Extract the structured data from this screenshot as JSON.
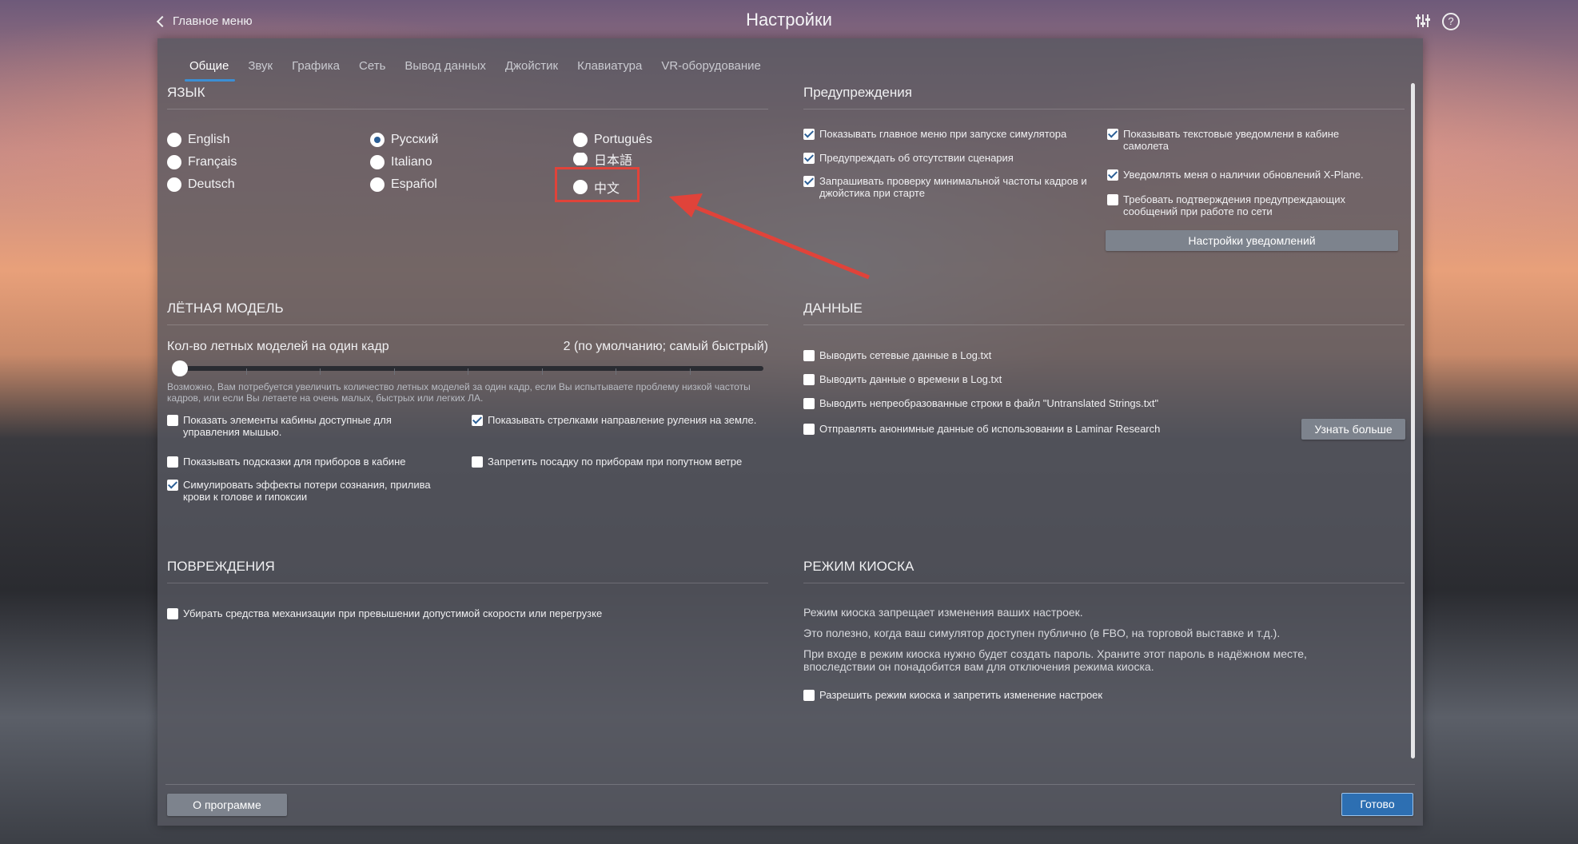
{
  "header": {
    "back_label": "Главное меню",
    "title": "Настройки",
    "settings_icon": "sliders-icon",
    "help_icon": "help-icon",
    "help_glyph": "?"
  },
  "tabs": [
    "Общие",
    "Звук",
    "Графика",
    "Сеть",
    "Вывод данных",
    "Джойстик",
    "Клавиатура",
    "VR-оборудование"
  ],
  "language": {
    "heading": "ЯЗЫК",
    "options": [
      "English",
      "Русский",
      "Português",
      "Français",
      "Italiano",
      "日本語",
      "Deutsch",
      "Español",
      "中文"
    ],
    "selected": "Русский"
  },
  "warnings": {
    "heading": "Предупреждения",
    "items": [
      {
        "label": "Показывать главное меню при запуске симулятора",
        "checked": true
      },
      {
        "label": "Предупреждать об отсутствии сценария",
        "checked": true
      },
      {
        "label": "Запрашивать проверку минимальной частоты кадров и джойстика при старте",
        "checked": true
      },
      {
        "label": "Показывать текстовые уведомлени в кабине самолета",
        "checked": true
      },
      {
        "label": "Уведомлять меня о наличии обновлений X-Plane.",
        "checked": true
      },
      {
        "label": "Требовать подтверждения предупреждающих сообщений при работе по сети",
        "checked": false
      }
    ],
    "button": "Настройки уведомлений"
  },
  "flight_model": {
    "heading": "ЛЁТНАЯ МОДЕЛЬ",
    "slider_label": "Кол-во летных моделей на один кадр",
    "slider_value_text": "2 (по умолчанию; самый быстрый)",
    "slider_fraction": 0,
    "note": "Возможно, Вам потребуется увеличить количество летных моделей за один кадр, если Вы испытываете проблему низкой частоты кадров, или если Вы летаете на очень малых, быстрых или легких ЛА.",
    "items": [
      {
        "label": "Показать элементы кабины доступные для управления мышью.",
        "checked": false
      },
      {
        "label": "Показывать стрелками направление руления на земле.",
        "checked": true
      },
      {
        "label": "Показывать подсказки для приборов в кабине",
        "checked": false
      },
      {
        "label": "Запретить посадку по приборам при попутном ветре",
        "checked": false
      },
      {
        "label": "Симулировать эффекты потери сознания, прилива крови к голове и гипоксии",
        "checked": true
      }
    ]
  },
  "data_section": {
    "heading": "ДАННЫЕ",
    "items": [
      {
        "label": "Выводить сетевые данные в Log.txt",
        "checked": false
      },
      {
        "label": "Выводить данные о времени в Log.txt",
        "checked": false
      },
      {
        "label": "Выводить непреобразованные строки в файл \"Untranslated Strings.txt\"",
        "checked": false
      },
      {
        "label": "Отправлять анонимные данные об использовании в  Laminar Research",
        "checked": false
      }
    ],
    "button": "Узнать больше"
  },
  "damage": {
    "heading": "ПОВРЕЖДЕНИЯ",
    "items": [
      {
        "label": "Убирать средства механизации при превышении допустимой скорости или перегрузке",
        "checked": false
      }
    ]
  },
  "kiosk": {
    "heading": "РЕЖИМ КИОСКА",
    "lines": [
      "Режим киоска запрещает изменения ваших настроек.",
      "Это полезно, когда ваш симулятор доступен публично (в FBO, на торговой выставке и т.д.).",
      "При входе в режим киоска нужно будет создать пароль. Храните этот пароль в надёжном месте, впоследствии он понадобится вам для отключения режима киоска."
    ],
    "items": [
      {
        "label": "Разрешить режим киоска и запретить изменение настроек",
        "checked": false
      }
    ]
  },
  "footer": {
    "about_button": "О программе",
    "done_button": "Готово"
  },
  "annotation": {
    "color": "#e0433a"
  }
}
